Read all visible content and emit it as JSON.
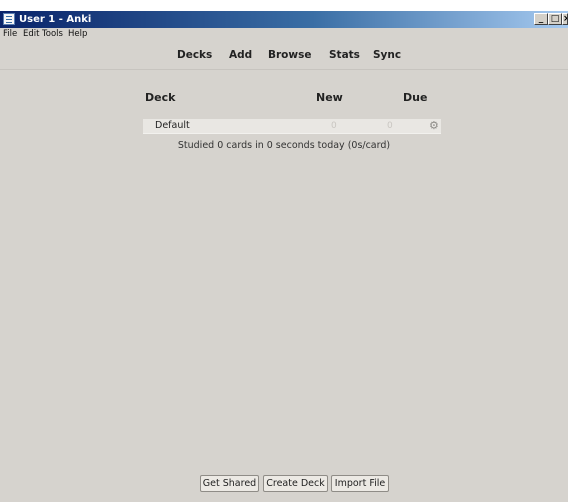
{
  "window": {
    "title": "User 1 - Anki",
    "controls": {
      "minimize": "_",
      "maximize": "□",
      "close": "×"
    }
  },
  "menu": {
    "file": "File",
    "edit": "Edit",
    "tools": "Tools",
    "help": "Help"
  },
  "toolbar": {
    "decks": "Decks",
    "add": "Add",
    "browse": "Browse",
    "stats": "Stats",
    "sync": "Sync"
  },
  "deck_list": {
    "headers": {
      "deck": "Deck",
      "new": "New",
      "due": "Due"
    },
    "rows": [
      {
        "name": "Default",
        "new": "0",
        "due": "0"
      }
    ],
    "options_icon": "gear-icon"
  },
  "studied_text": "Studied 0 cards in 0 seconds today (0s/card)",
  "bottom_buttons": {
    "get_shared": "Get Shared",
    "create_deck": "Create Deck",
    "import_file": "Import File"
  },
  "colors": {
    "background": "#d6d3ce",
    "titlebar_start": "#0a246a",
    "titlebar_end": "#a6caf0"
  }
}
